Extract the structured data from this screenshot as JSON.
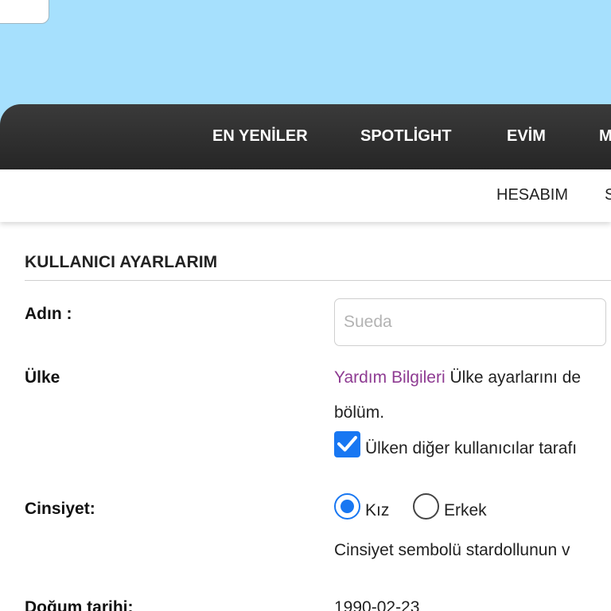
{
  "main_nav": {
    "items": [
      "EN YENİLER",
      "SPOTLİGHT",
      "EVİM",
      "M"
    ]
  },
  "sub_nav": {
    "items": [
      "HESABIM",
      "S"
    ]
  },
  "settings": {
    "title": "KULLANICI AYARLARIM",
    "name": {
      "label": "Adın :",
      "placeholder": "Sueda",
      "value": ""
    },
    "country": {
      "label": "Ülke",
      "help_link": "Yardım Bilgileri",
      "help_text": " Ülke ayarlarını de",
      "help_text_cont": "bölüm.",
      "visibility_checked": true,
      "visibility_label": "Ülken diğer kullanıcılar tarafı"
    },
    "gender": {
      "label": "Cinsiyet:",
      "options": [
        "Kız",
        "Erkek"
      ],
      "selected": "Kız",
      "note": "Cinsiyet sembolü stardollunun v"
    },
    "birth": {
      "label": "Doğum tarihi:",
      "value": "1990-02-23"
    }
  },
  "colors": {
    "sky": "#a6e0fd",
    "nav_dark": "#2e2e2e",
    "accent_blue": "#1877f2",
    "link_purple": "#8e3b92"
  }
}
